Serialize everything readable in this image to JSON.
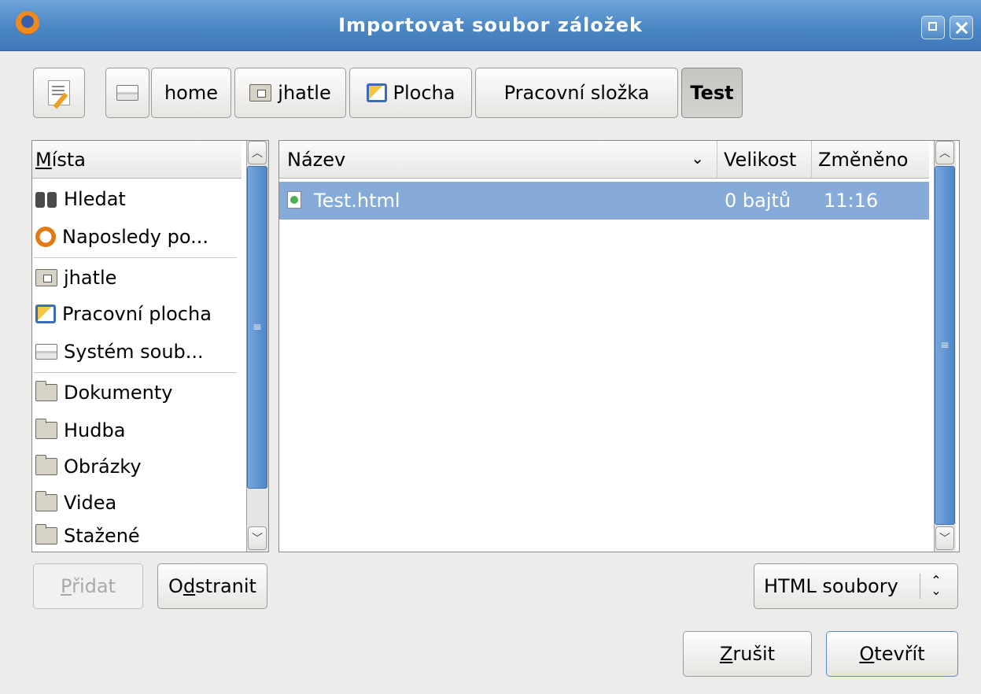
{
  "window": {
    "title": "Importovat soubor záložek"
  },
  "pathbar": {
    "segments": [
      {
        "label": "home",
        "icon": "drive-icon"
      },
      {
        "label": "jhatle",
        "icon": "home-folder-icon"
      },
      {
        "label": "Plocha",
        "icon": "desktop-icon"
      },
      {
        "label": "Pracovní složka",
        "icon": ""
      },
      {
        "label": "Test",
        "icon": "",
        "active": true
      }
    ]
  },
  "places": {
    "header": "Místa",
    "header_mnemonic": "M",
    "header_rest": "ísta",
    "items": [
      {
        "label": "Hledat",
        "icon": "search-icon"
      },
      {
        "label": "Naposledy po...",
        "icon": "recent-icon"
      },
      {
        "label": "jhatle",
        "icon": "home-folder-icon"
      },
      {
        "label": "Pracovní plocha",
        "icon": "desktop-icon"
      },
      {
        "label": "Systém soub...",
        "icon": "drive-icon"
      },
      {
        "label": "Dokumenty",
        "icon": "folder-icon"
      },
      {
        "label": "Hudba",
        "icon": "folder-icon"
      },
      {
        "label": "Obrázky",
        "icon": "folder-icon"
      },
      {
        "label": "Videa",
        "icon": "folder-icon"
      },
      {
        "label": "Stažené",
        "icon": "folder-icon"
      }
    ]
  },
  "files": {
    "columns": {
      "name": "Název",
      "size": "Velikost",
      "modified": "Změněno"
    },
    "rows": [
      {
        "name": "Test.html",
        "size": "0 bajtů",
        "modified": "11:16",
        "selected": true
      }
    ]
  },
  "buttons": {
    "add": {
      "mnemonic": "P",
      "rest": "řidat"
    },
    "remove": {
      "pre": "O",
      "mnemonic": "d",
      "rest": "stranit"
    },
    "cancel": {
      "mnemonic": "Z",
      "rest": "rušit"
    },
    "open": {
      "mnemonic": "O",
      "rest": "tevřít"
    }
  },
  "filter": {
    "selected": "HTML soubory"
  },
  "colors": {
    "titlebar": "#4c87c5",
    "selection": "#86abd9",
    "window_bg": "#edeceb"
  }
}
